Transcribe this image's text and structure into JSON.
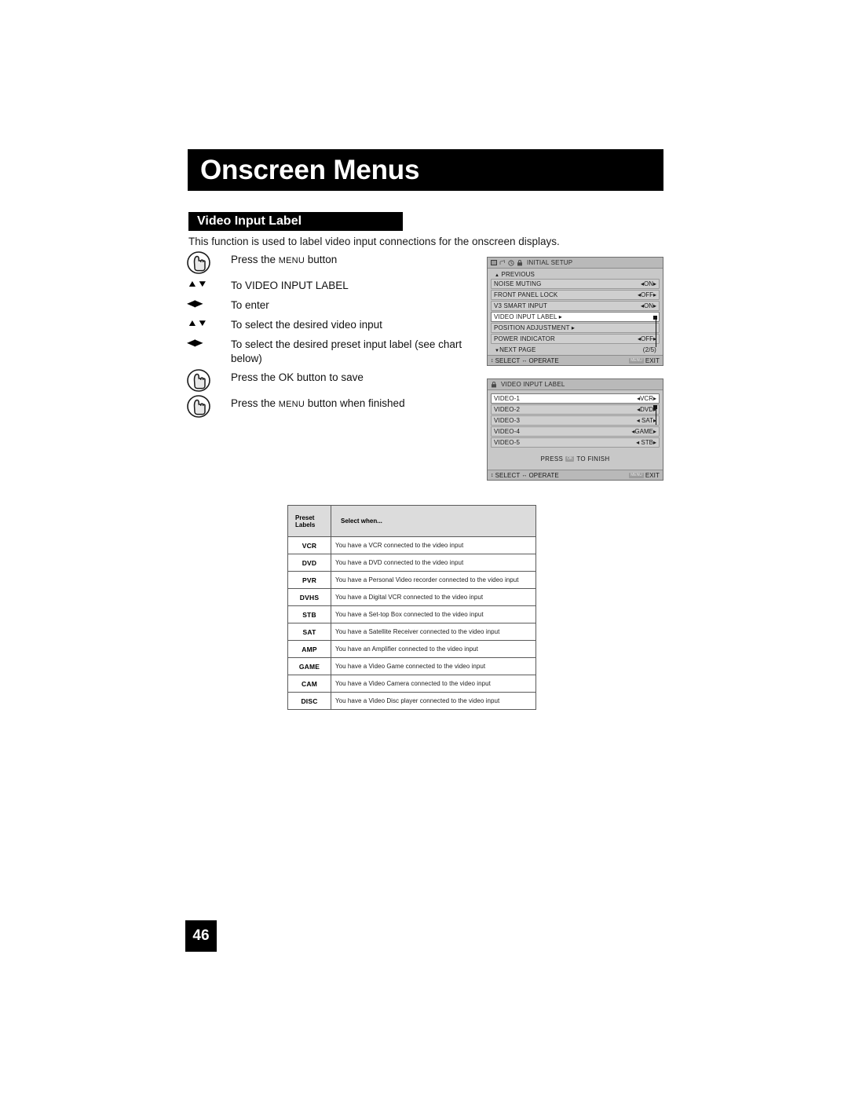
{
  "page": {
    "chapter_title": "Onscreen Menus",
    "section_title": "Video Input Label",
    "intro": "This function is used to label video input connections for the onscreen displays.",
    "page_number": "46"
  },
  "steps": [
    {
      "control": "hand",
      "text": "Press the ",
      "smallcap": "MENU",
      "text2": " button"
    },
    {
      "control": "updown",
      "text": "To VIDEO INPUT LABEL",
      "smallcap": "",
      "text2": ""
    },
    {
      "control": "leftright",
      "text": "To enter",
      "smallcap": "",
      "text2": ""
    },
    {
      "control": "updown",
      "text": "To select the desired video input",
      "smallcap": "",
      "text2": ""
    },
    {
      "control": "leftright",
      "text": "To select the desired preset input label (see chart below)",
      "smallcap": "",
      "text2": ""
    },
    {
      "control": "hand",
      "text": "Press the OK button to save",
      "smallcap": "",
      "text2": ""
    },
    {
      "control": "hand",
      "text": "Press the ",
      "smallcap": "MENU",
      "text2": " button when finished"
    }
  ],
  "osd_initial_setup": {
    "title": "INITIAL SETUP",
    "header_icons": [
      "picture-icon",
      "sound-icon",
      "clock-icon",
      "setup-icon"
    ],
    "previous_label": "PREVIOUS",
    "rows": [
      {
        "label": "NOISE MUTING",
        "value": "ON",
        "selected": false,
        "submenu": false
      },
      {
        "label": "FRONT PANEL LOCK",
        "value": "OFF",
        "selected": false,
        "submenu": false
      },
      {
        "label": "V3 SMART INPUT",
        "value": "ON",
        "selected": false,
        "submenu": false
      },
      {
        "label": "VIDEO INPUT LABEL",
        "value": "",
        "selected": true,
        "submenu": true
      },
      {
        "label": "POSITION ADJUSTMENT",
        "value": "",
        "selected": false,
        "submenu": true
      },
      {
        "label": "POWER INDICATOR",
        "value": "OFF",
        "selected": false,
        "submenu": false
      }
    ],
    "next_page_label": "NEXT PAGE",
    "page_indicator": "(2/5)",
    "footer_select": "SELECT",
    "footer_operate": "OPERATE",
    "footer_key": "MENU",
    "footer_exit": "EXIT"
  },
  "osd_video_input_label": {
    "title": "VIDEO INPUT LABEL",
    "header_icons": [
      "setup-icon"
    ],
    "rows": [
      {
        "label": "VIDEO-1",
        "value": "VCR",
        "selected": true
      },
      {
        "label": "VIDEO-2",
        "value": "DVD",
        "selected": false
      },
      {
        "label": "VIDEO-3",
        "value": "SAT",
        "selected": false
      },
      {
        "label": "VIDEO-4",
        "value": "GAME",
        "selected": false
      },
      {
        "label": "VIDEO-5",
        "value": "STB",
        "selected": false
      }
    ],
    "finish_prefix": "PRESS",
    "finish_key": "OK",
    "finish_suffix": "TO FINISH",
    "footer_select": "SELECT",
    "footer_operate": "OPERATE",
    "footer_key": "MENU",
    "footer_exit": "EXIT"
  },
  "preset_table": {
    "headers": [
      "Preset\nLabels",
      "Select when..."
    ],
    "header_label_line1": "Preset",
    "header_label_line2": "Labels",
    "header_desc": "Select when...",
    "rows": [
      {
        "label": "VCR",
        "desc": "You have a VCR connected to the video input"
      },
      {
        "label": "DVD",
        "desc": "You have a DVD connected to the video input"
      },
      {
        "label": "PVR",
        "desc": "You have a Personal Video recorder connected to the video input"
      },
      {
        "label": "DVHS",
        "desc": "You have a Digital VCR connected to the video input"
      },
      {
        "label": "STB",
        "desc": "You have a Set-top Box connected to the video input"
      },
      {
        "label": "SAT",
        "desc": "You have a Satellite Receiver connected to the video input"
      },
      {
        "label": "AMP",
        "desc": "You have an Amplifier connected to the video input"
      },
      {
        "label": "GAME",
        "desc": "You have a Video Game connected to the video input"
      },
      {
        "label": "CAM",
        "desc": "You have a Video Camera connected to the video input"
      },
      {
        "label": "DISC",
        "desc": "You have a Video Disc player connected to the video input"
      }
    ]
  },
  "colors": {
    "banner": "#000000",
    "osd_bg": "#c8c8c8",
    "osd_head": "#b9b9b9",
    "osd_row": "#cfcfcf",
    "osd_row_selected": "#ffffff",
    "table_header": "#dcdcdc"
  }
}
